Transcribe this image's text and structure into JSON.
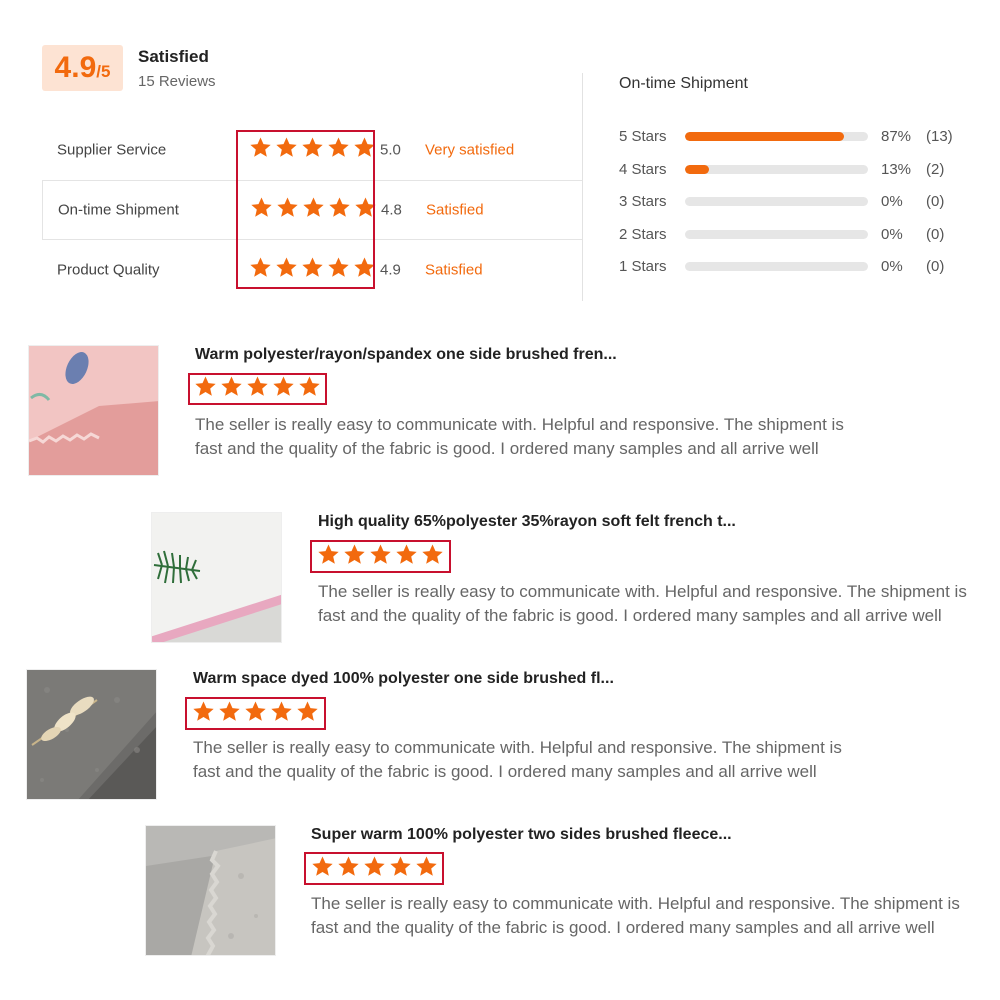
{
  "summary": {
    "score": "4.9",
    "score_max": "/5",
    "label": "Satisfied",
    "reviews": "15 Reviews"
  },
  "ratings": [
    {
      "name": "Supplier Service",
      "value": "5.0",
      "word": "Very satisfied"
    },
    {
      "name": "On-time Shipment",
      "value": "4.8",
      "word": "Satisfied"
    },
    {
      "name": "Product Quality",
      "value": "4.9",
      "word": "Satisfied"
    }
  ],
  "distribution": {
    "title": "On-time Shipment",
    "rows": [
      {
        "label": "5  Stars",
        "fill_pct": 87,
        "pct": "87%",
        "count": "(13)"
      },
      {
        "label": "4  Stars",
        "fill_pct": 13,
        "pct": "13%",
        "count": "(2)"
      },
      {
        "label": "3  Stars",
        "fill_pct": 0,
        "pct": "0%",
        "count": "(0)"
      },
      {
        "label": "2  Stars",
        "fill_pct": 0,
        "pct": "0%",
        "count": "(0)"
      },
      {
        "label": "1  Stars",
        "fill_pct": 0,
        "pct": "0%",
        "count": "(0)"
      }
    ]
  },
  "reviews": [
    {
      "title": "Warm polyester/rayon/spandex one side brushed fren...",
      "text": "The seller is really easy to communicate with. Helpful and responsive. The shipment is fast and the quality of the fabric is good. I ordered many samples and all arrive well"
    },
    {
      "title": "High quality 65%polyester 35%rayon soft felt french t...",
      "text": "The seller is really easy to communicate with. Helpful and responsive. The shipment is fast and the quality of the fabric is good. I ordered many samples and all arrive well"
    },
    {
      "title": "Warm space dyed 100% polyester one side brushed fl...",
      "text": "The seller is really easy to communicate with. Helpful and responsive. The shipment is fast and the quality of the fabric is good. I ordered many samples and all arrive well"
    },
    {
      "title": "Super warm 100% polyester two sides brushed fleece...",
      "text": "The seller is really easy to communicate with. Helpful and responsive. The shipment is fast and the quality of the fabric is good. I ordered many samples and all arrive well"
    }
  ],
  "colors": {
    "accent": "#f26a0e",
    "highlight": "#c8102e",
    "badge_bg": "#fde3d3"
  },
  "icons": {
    "star": "star-icon"
  }
}
